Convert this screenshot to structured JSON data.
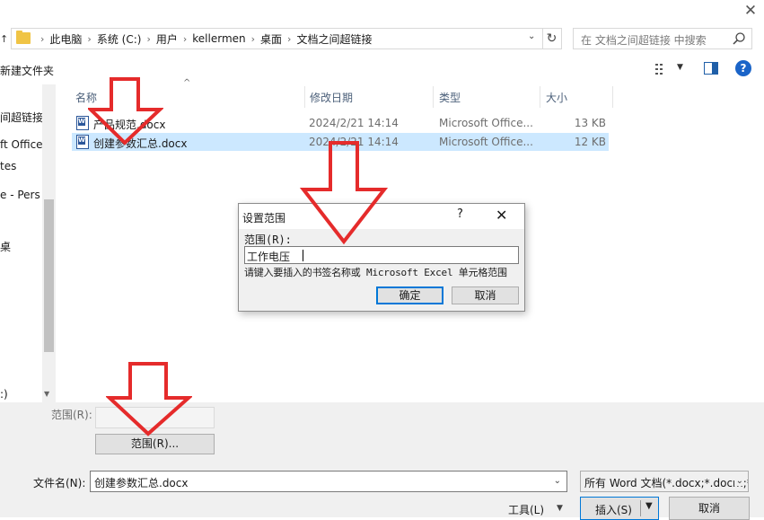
{
  "address": {
    "crumbs": [
      "此电脑",
      "系统 (C:)",
      "用户",
      "kellermen",
      "桌面",
      "文档之间超链接"
    ],
    "search_placeholder": "在 文档之间超链接 中搜索"
  },
  "toolbar": {
    "new_folder": "新建文件夹",
    "help": "?"
  },
  "nav_pane": {
    "items": [
      "间超链接",
      "ft Office",
      "tes",
      "e - Pers",
      "桌",
      ":)"
    ]
  },
  "list": {
    "columns": {
      "name": "名称",
      "date": "修改日期",
      "type": "类型",
      "size": "大小"
    },
    "rows": [
      {
        "name": "产品规范.docx",
        "date": "2024/2/21 14:14",
        "type": "Microsoft Office...",
        "size": "13 KB",
        "selected": false
      },
      {
        "name": "创建参数汇总.docx",
        "date": "2024/2/21 14:14",
        "type": "Microsoft Office...",
        "size": "12 KB",
        "selected": true
      }
    ]
  },
  "bottom": {
    "range_label": "范围(R):",
    "range_button": "范围(R)...",
    "filename_label": "文件名(N):",
    "filename_value": "创建参数汇总.docx",
    "filetype_value": "所有 Word 文档(*.docx;*.docm;*.dotx)",
    "tools_label": "工具(L)",
    "insert_label": "插入(S)",
    "cancel_label": "取消"
  },
  "dialog": {
    "title": "设置范围",
    "help": "?",
    "range_label": "范围(R):",
    "input_value": "工作电压",
    "hint": "请键入要插入的书签名称或 Microsoft Excel 单元格范围",
    "ok": "确定",
    "cancel": "取消"
  },
  "colors": {
    "selection": "#cce8ff",
    "accent": "#0078d7",
    "annotation_arrow": "#e52b2b",
    "folder": "#f0c445"
  }
}
